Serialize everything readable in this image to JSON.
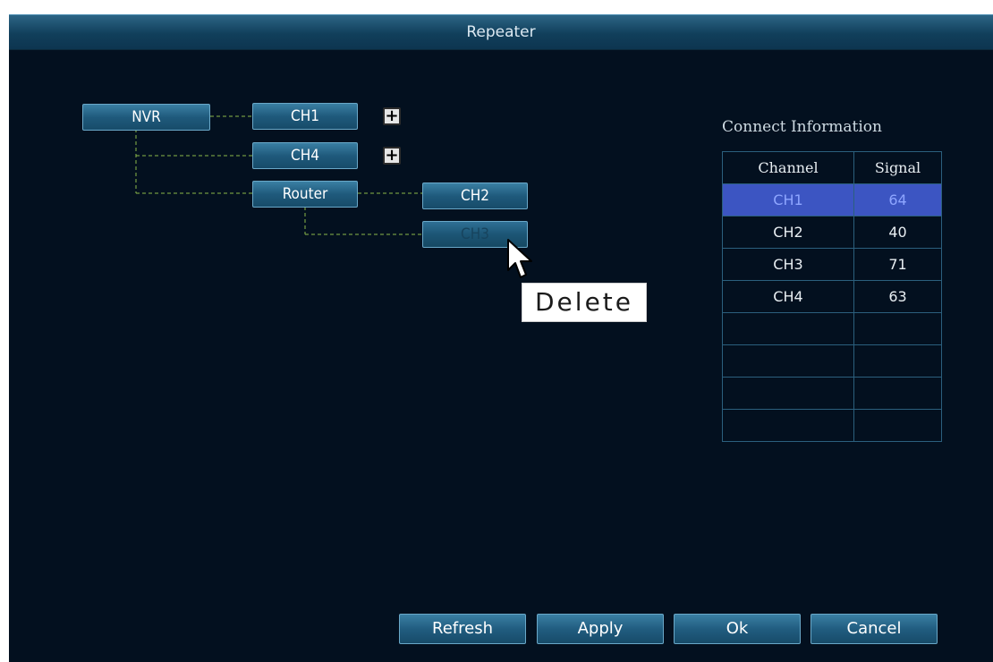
{
  "window": {
    "title": "Repeater"
  },
  "topology": {
    "nvr_label": "NVR",
    "ch1_label": "CH1",
    "ch4_label": "CH4",
    "router_label": "Router",
    "ch2_label": "CH2",
    "ch3_label": "CH3",
    "add_symbol": "+"
  },
  "connect_info": {
    "title": "Connect Information",
    "headers": [
      "Channel",
      "Signal"
    ],
    "rows": [
      {
        "channel": "CH1",
        "signal": "64",
        "selected": true
      },
      {
        "channel": "CH2",
        "signal": "40",
        "selected": false
      },
      {
        "channel": "CH3",
        "signal": "71",
        "selected": false
      },
      {
        "channel": "CH4",
        "signal": "63",
        "selected": false
      },
      {
        "channel": "",
        "signal": "",
        "selected": false
      },
      {
        "channel": "",
        "signal": "",
        "selected": false
      },
      {
        "channel": "",
        "signal": "",
        "selected": false
      },
      {
        "channel": "",
        "signal": "",
        "selected": false
      }
    ]
  },
  "tooltip": {
    "text": "Delete"
  },
  "buttons": {
    "refresh": "Refresh",
    "apply": "Apply",
    "ok": "Ok",
    "cancel": "Cancel"
  },
  "colors": {
    "background": "#03101f",
    "title_bar": "#1d5475",
    "node_button": "#2a6b8f",
    "selected_row": "#3c55c2",
    "link_line": "#8bb84a"
  },
  "icons": [
    "plus-icon",
    "mouse-pointer-icon"
  ]
}
